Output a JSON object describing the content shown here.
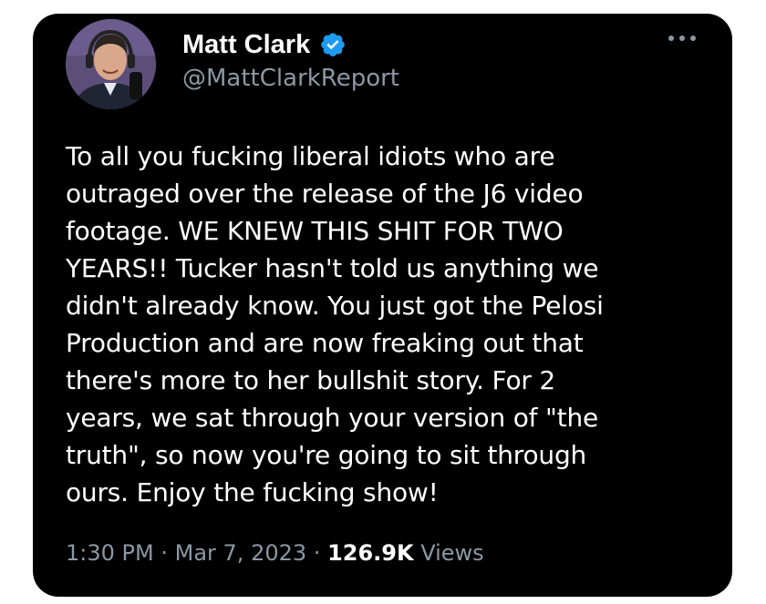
{
  "tweet": {
    "author": {
      "display_name": "Matt Clark",
      "handle": "@MattClarkReport",
      "verified": true,
      "verified_color": "#1d9bf0",
      "avatar_icon": "profile-photo"
    },
    "more_icon": "more-horizontal-icon",
    "text": "To all you fucking liberal idiots who are\noutraged over the release of the J6 video\nfootage. WE KNEW THIS SHIT FOR TWO\nYEARS!! Tucker hasn't told us anything we\ndidn't already know. You just got the Pelosi\nProduction and are now freaking out that\nthere's more to her bullshit story. For 2\nyears, we sat through your version of \"the\ntruth\", so now you're going to sit through\nours. Enjoy the fucking show!",
    "time": "1:30 PM",
    "separator": "·",
    "date": "Mar 7, 2023",
    "views_count": "126.9K",
    "views_label": "Views"
  },
  "colors": {
    "card_background": "#000000",
    "text_primary": "#ffffff",
    "text_secondary": "#8b98a5"
  }
}
